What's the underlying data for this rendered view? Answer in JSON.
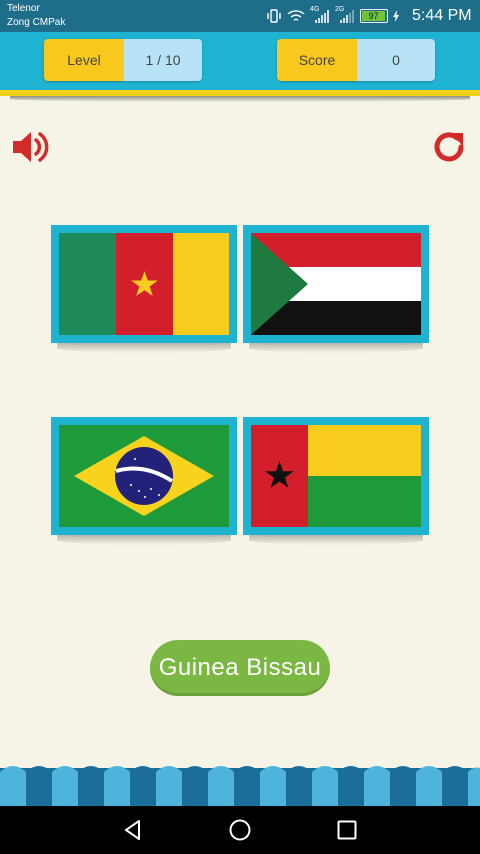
{
  "status_bar": {
    "carrier_1": "Telenor",
    "carrier_2": "Zong CMPak",
    "network_1": "4G",
    "network_2": "2G",
    "battery": "97",
    "time": "5:44 PM"
  },
  "header": {
    "level_label": "Level",
    "level_value": "1 / 10",
    "score_label": "Score",
    "score_value": "0"
  },
  "controls": {
    "sound_icon": "speaker-icon",
    "refresh_icon": "refresh-icon"
  },
  "flags": [
    {
      "country": "Cameroon"
    },
    {
      "country": "Sudan"
    },
    {
      "country": "Brazil"
    },
    {
      "country": "Guinea Bissau"
    }
  ],
  "answer": {
    "label": "Guinea Bissau"
  },
  "colors": {
    "header_bg": "#1fb3d2",
    "header_stripe": "#f5d218",
    "pill_label": "#f8c81d",
    "pill_value": "#b8e2f5",
    "answer_button": "#7ab843",
    "icon_red": "#d32a2a",
    "page_bg": "#f5f4e6"
  }
}
